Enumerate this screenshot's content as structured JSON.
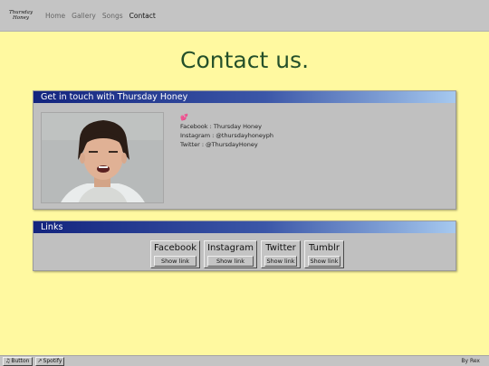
{
  "navbar": {
    "logo_line1": "Thursday",
    "logo_line2": "Honey",
    "links": [
      "Home",
      "Gallery",
      "Songs",
      "Contact"
    ],
    "active": "Contact"
  },
  "page_title": "Contact us.",
  "contact_panel": {
    "header": "Get in touch with Thursday Honey",
    "heart_icon": "heart-emoji",
    "lines": [
      "Facebook : Thursday Honey",
      "Instagram : @thursdayhoneyph",
      "Twitter : @ThursdayHoney"
    ]
  },
  "links_panel": {
    "header": "Links",
    "items": [
      {
        "name": "Facebook",
        "action": "Show link"
      },
      {
        "name": "Instagram",
        "action": "Show link"
      },
      {
        "name": "Twitter",
        "action": "Show link"
      },
      {
        "name": "Tumblr",
        "action": "Show link"
      }
    ]
  },
  "footer": {
    "button1": "Button",
    "button2": "Spotify",
    "byline": "By Rex"
  },
  "colors": {
    "background": "#fff9a0",
    "title": "#24502a",
    "header_gradient_start": "#13247e",
    "header_gradient_end": "#a6c9ef"
  }
}
